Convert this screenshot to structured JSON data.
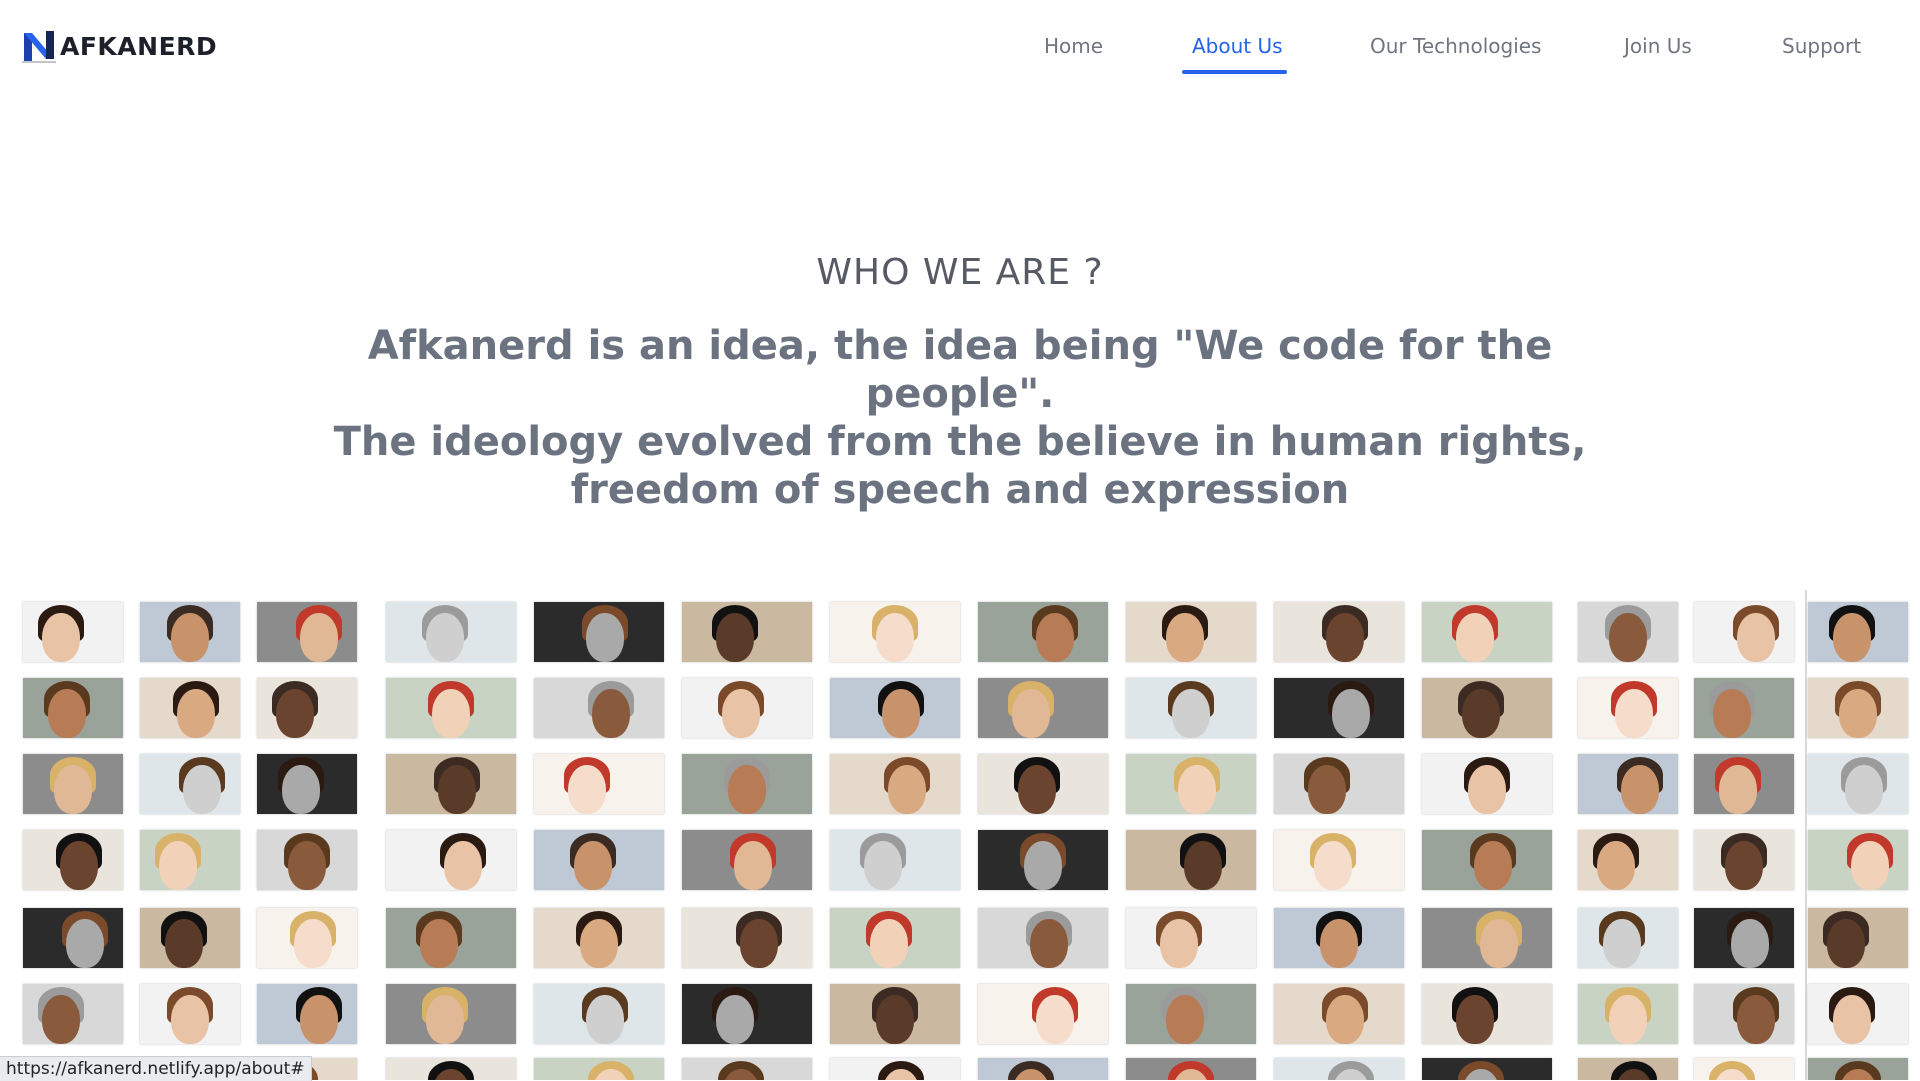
{
  "brand": {
    "name": "AFKANERD",
    "accent": "#2563eb"
  },
  "nav": {
    "items": [
      {
        "label": "Home",
        "active": false
      },
      {
        "label": "About Us",
        "active": true
      },
      {
        "label": "Our Technologies",
        "active": false
      },
      {
        "label": "Join Us",
        "active": false
      },
      {
        "label": "Support",
        "active": false
      }
    ]
  },
  "about": {
    "title": "WHO WE ARE ?",
    "mission_line1": "Afkanerd is an idea, the idea being \"We code for the people\".",
    "mission_line2": "The ideology evolved from the believe in human rights, freedom of speech and expression"
  },
  "photo_wall": {
    "subject": "portrait-photos"
  },
  "status_bar": {
    "url": "https://afkanerd.netlify.app/about#"
  }
}
